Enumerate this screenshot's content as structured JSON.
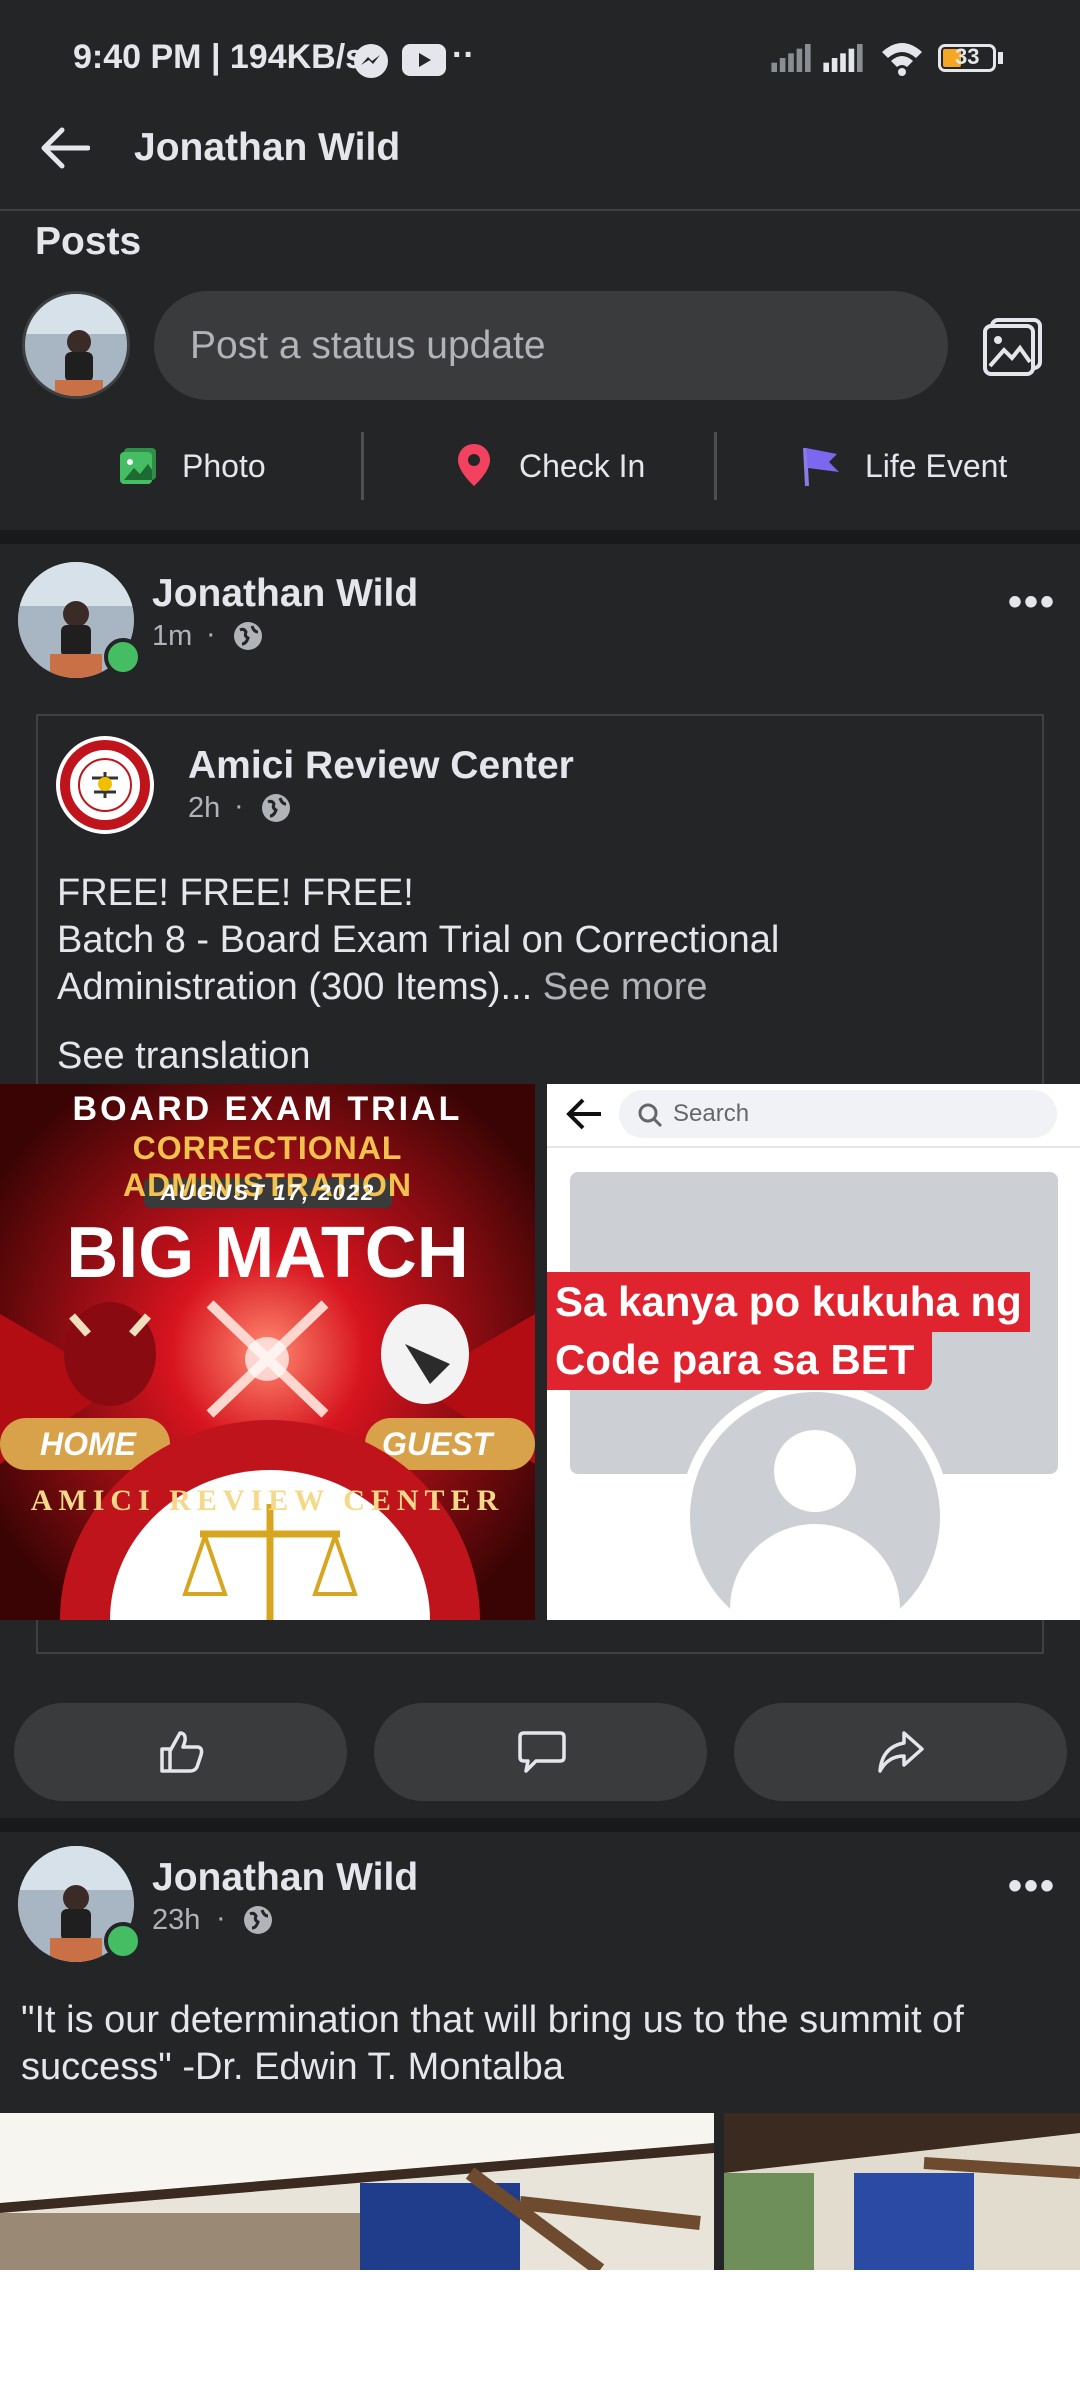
{
  "status_bar": {
    "time_speed": "9:40 PM | 194KB/s",
    "battery": "33"
  },
  "app_bar": {
    "title": "Jonathan Wild"
  },
  "posts_section": {
    "title": "Posts",
    "composer_placeholder": "Post a status update",
    "quick_actions": [
      {
        "label": "Photo",
        "icon": "photo-icon",
        "color": "#45bd62"
      },
      {
        "label": "Check In",
        "icon": "location-pin-icon",
        "color": "#f3425f"
      },
      {
        "label": "Life Event",
        "icon": "flag-icon",
        "color": "#7b68ee"
      }
    ]
  },
  "post1": {
    "author": "Jonathan Wild",
    "time": "1m",
    "shared": {
      "page": "Amici Review Center",
      "time": "2h",
      "text_line1": "FREE! FREE! FREE!",
      "text_line2": "Batch 8 - Board Exam Trial on Correctional",
      "text_line3": "Administration (300 Items)...",
      "see_more": "See more",
      "see_translation": "See translation"
    },
    "image_left": {
      "line1": "BOARD EXAM TRIAL",
      "line2": "CORRECTIONAL ADMINISTRATION",
      "date": "AUGUST 17, 2022",
      "headline": "BIG MATCH",
      "home": "HOME",
      "guest": "GUEST",
      "seal_text": "AMICI REVIEW CENTER"
    },
    "image_right": {
      "search_placeholder": "Search",
      "caption_line1": "Sa kanya po kukuha ng",
      "caption_line2": "Code para sa BET"
    }
  },
  "post2": {
    "author": "Jonathan Wild",
    "time": "23h",
    "text": "\"It is our determination that will bring us to the summit of success\" -Dr. Edwin T. Montalba"
  },
  "colors": {
    "background": "#242526",
    "separator": "#18191a",
    "accent_red": "#e0242f",
    "online": "#45bd62"
  }
}
